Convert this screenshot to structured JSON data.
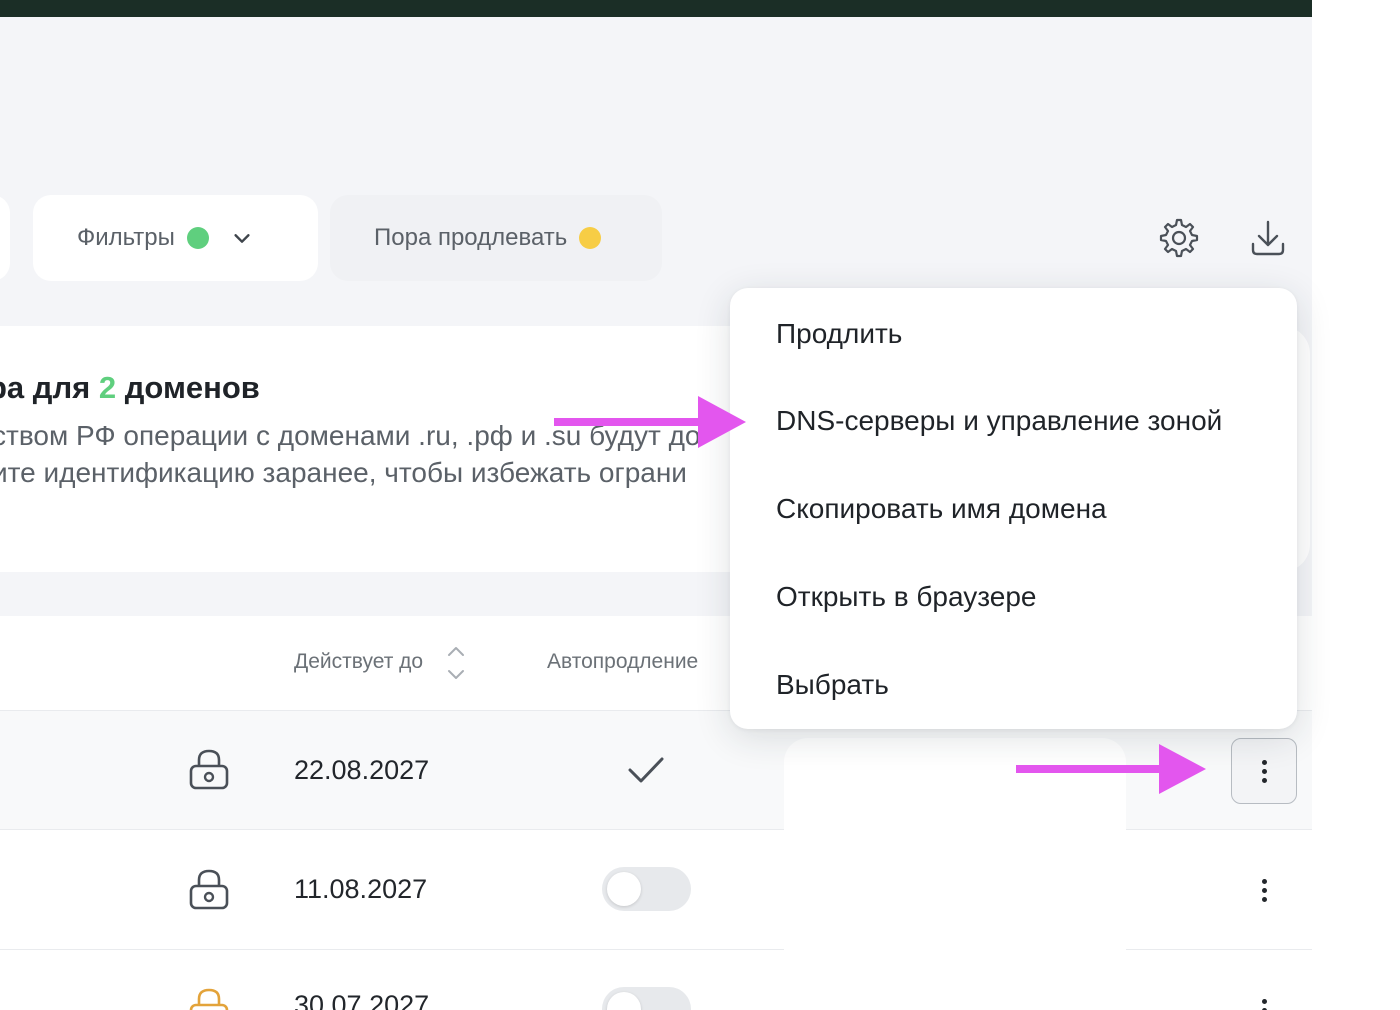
{
  "colors": {
    "topbar": "#1b2e26",
    "accent_green": "#5fcf7e",
    "accent_yellow": "#f7cd45",
    "annotation_magenta": "#e356ee",
    "lock_warning": "#e3a33a"
  },
  "toolbar": {
    "filters_label": "Фильтры",
    "filters_dot_icon": "green-dot",
    "filters_chevron_icon": "chevron-down-icon",
    "renew_label": "Пора продлевать",
    "renew_dot_icon": "yellow-dot",
    "settings_icon": "gear-icon",
    "download_icon": "download-icon"
  },
  "banner": {
    "title_prefix": "ра для ",
    "title_count": "2",
    "title_suffix": " доменов",
    "line1": "ством РФ операции с доменами .ru, .рф и .su будут до",
    "line2": "ите идентификацию заранее, чтобы избежать ограни"
  },
  "table": {
    "headers": [
      {
        "label": "Действует до",
        "icon": "sort-icon"
      },
      {
        "label": "Автопродление",
        "icon": "sort-icon"
      }
    ],
    "rows": [
      {
        "lock": "lock-icon",
        "date": "22.08.2027",
        "autorenew": "check",
        "more": "more-vertical-icon"
      },
      {
        "lock": "lock-icon",
        "date": "11.08.2027",
        "autorenew": "toggle-off",
        "more": "more-vertical-icon"
      },
      {
        "lock": "lock-open-icon",
        "date": "30.07.2027",
        "autorenew": "toggle-off",
        "more": "more-vertical-icon"
      }
    ]
  },
  "context_menu": {
    "items": [
      "Продлить",
      "DNS-серверы и управление зоной",
      "Скопировать имя домена",
      "Открыть в браузере",
      "Выбрать"
    ]
  },
  "annotations": {
    "arrow_to_menu_item": "arrow-right-icon",
    "arrow_to_more_button": "arrow-right-icon"
  }
}
